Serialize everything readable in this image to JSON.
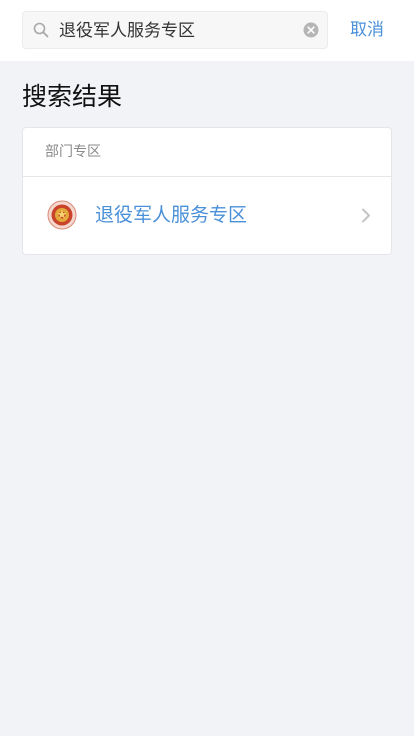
{
  "search": {
    "value": "退役军人服务专区",
    "search_icon": "search-icon",
    "clear_icon": "clear-icon"
  },
  "header": {
    "cancel_label": "取消"
  },
  "results": {
    "title": "搜索结果",
    "card": {
      "header": "部门专区",
      "items": [
        {
          "label": "退役军人服务专区",
          "icon": "emblem-icon",
          "chevron": "chevron-right-icon"
        }
      ]
    }
  },
  "colors": {
    "accent": "#4a90d9",
    "background": "#f2f3f7",
    "emblem_red": "#c9432b",
    "emblem_gold": "#e2a93a"
  }
}
